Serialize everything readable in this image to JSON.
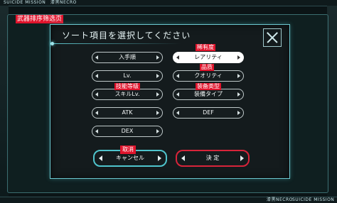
{
  "topbar": {
    "left": "SUICIDE MISSION",
    "right": "漆黒NECRO"
  },
  "bottombar": {
    "left": "漆黒NECRO",
    "right": "SUICIDE MISSION"
  },
  "annotations": {
    "weapon_sort_filter": "武器排序筛选页",
    "rarity": "稀有度",
    "quality": "品质",
    "skill_level": "技能等级",
    "equip_type": "装备类型",
    "cancel": "取消"
  },
  "dialog": {
    "title": "ソート項目を選択してください",
    "options": {
      "acquired": "入手順",
      "rarity": "レアリティ",
      "lv": "Lv.",
      "quality": "クオリティ",
      "skill_lv": "スキルLv.",
      "equip_type": "装備タイプ",
      "atk": "ATK",
      "def": "DEF",
      "dex": "DEX"
    },
    "cancel_label": "キャンセル",
    "confirm_label": "決 定"
  },
  "colors": {
    "accent_cyan": "#6cc8d0",
    "accent_red": "#e0142c"
  }
}
